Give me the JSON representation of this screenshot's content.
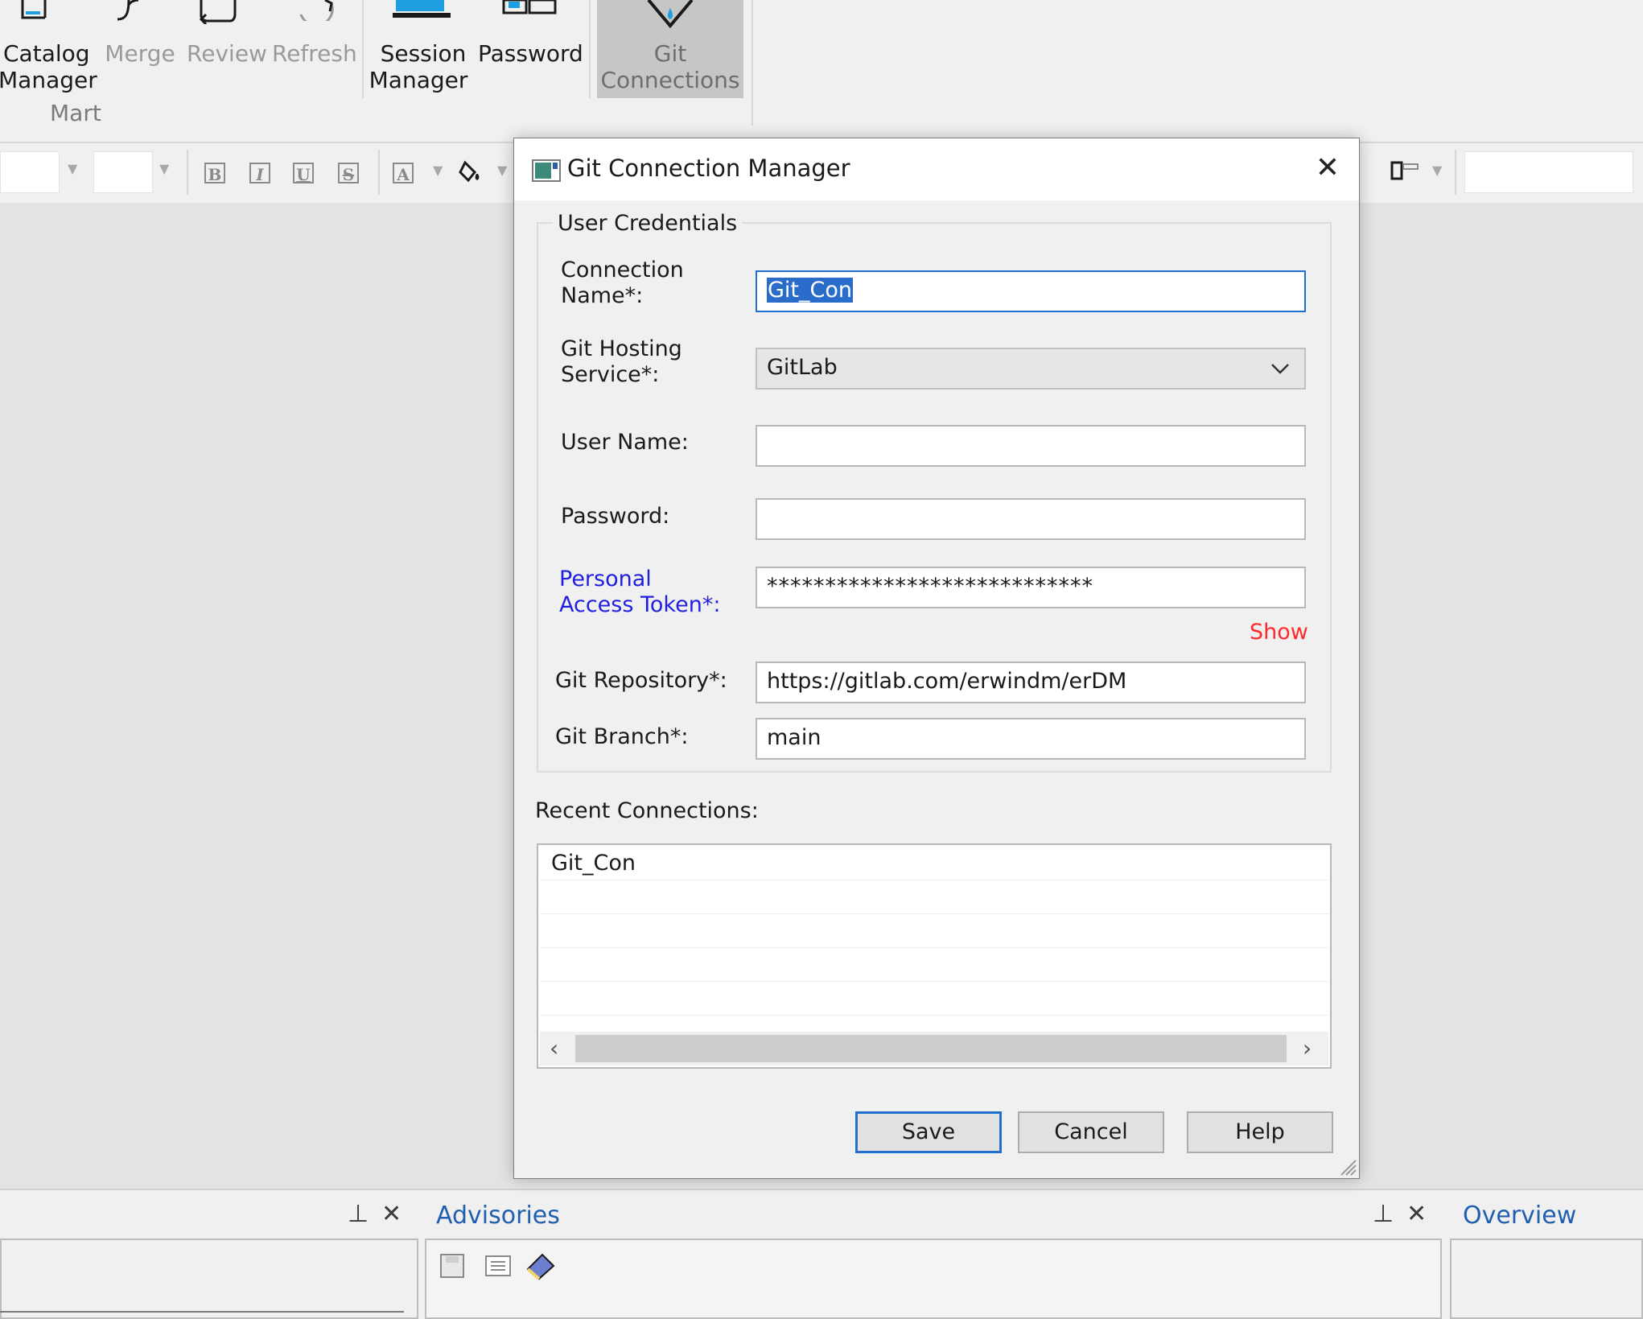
{
  "ribbon": {
    "buttons": {
      "catalog_manager": {
        "line1": "Catalog",
        "line2": "Manager"
      },
      "merge": {
        "line1": "Merge"
      },
      "review": {
        "line1": "Review"
      },
      "refresh": {
        "line1": "Refresh"
      },
      "session_manager": {
        "line1": "Session",
        "line2": "Manager"
      },
      "password": {
        "line1": "Password"
      },
      "git_connections": {
        "line1": "Git",
        "line2": "Connections"
      }
    },
    "group_label": "Mart"
  },
  "format_toolbar": {
    "icons": [
      "bold-icon",
      "italic-icon",
      "underline-icon",
      "strikethrough-icon",
      "font-color-icon",
      "fill-color-icon",
      "align-icon"
    ],
    "glyphs": {
      "bold": "B",
      "italic": "I",
      "underline": "U",
      "strike": "S",
      "font_color": "A"
    }
  },
  "dialog": {
    "title": "Git Connection Manager",
    "close_glyph": "✕",
    "group_title": "User Credentials",
    "fields": {
      "connection_name": {
        "label1": "Connection",
        "label2": "Name*:",
        "value": "Git_Con"
      },
      "hosting_service": {
        "label1": "Git Hosting",
        "label2": "Service*:",
        "value": "GitLab"
      },
      "user_name": {
        "label": "User Name:",
        "value": ""
      },
      "password": {
        "label": "Password:",
        "value": ""
      },
      "token": {
        "label1": "Personal",
        "label2": "Access Token*:",
        "value": "****************************"
      },
      "repository": {
        "label": "Git Repository*:",
        "value": "https://gitlab.com/erwindm/erDM"
      },
      "branch": {
        "label": "Git Branch*:",
        "value": "main"
      }
    },
    "show_link": "Show",
    "recent_label": "Recent Connections:",
    "recent_items": [
      "Git_Con"
    ],
    "buttons": {
      "save": "Save",
      "cancel": "Cancel",
      "help": "Help"
    }
  },
  "bottom": {
    "advisories_title": "Advisories",
    "overview_title": "Overview",
    "pin_glyph": "⊥",
    "close_glyph": "✕"
  }
}
